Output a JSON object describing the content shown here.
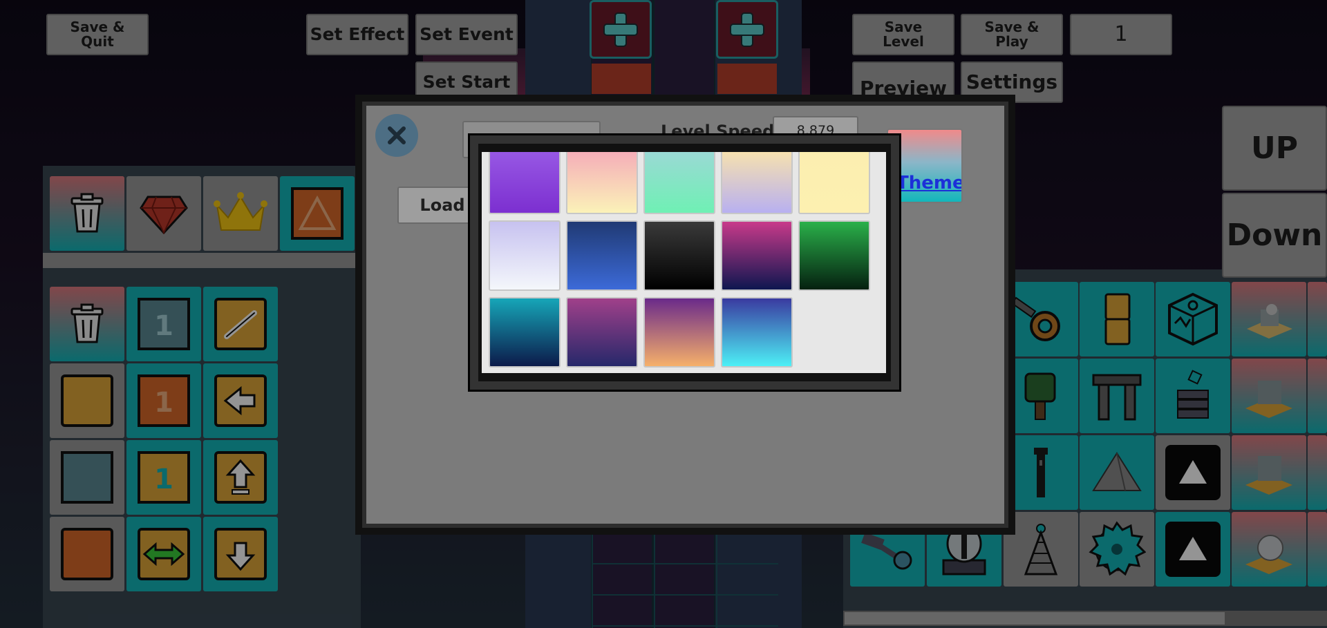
{
  "top_bar": {
    "save_quit": "Save &\nQuit",
    "set_effect": "Set Effect",
    "set_event": "Set Event",
    "set_start": "Set Start",
    "save_level": "Save\nLevel",
    "save_play": "Save &\nPlay",
    "level_number": "1",
    "preview": "Preview",
    "settings": "Settings"
  },
  "side_nav": {
    "up": "UP",
    "down": "Down"
  },
  "dialog": {
    "level_speed_label": "Level Speed:",
    "level_speed_value": "8.879",
    "load_label": "Load",
    "theme_label": "Theme"
  },
  "themes": [
    {
      "name": "purple-city",
      "top": "#9a5ce6",
      "bottom": "#7c2fd0"
    },
    {
      "name": "pink-castle",
      "top": "#f4a6b8",
      "bottom": "#fbf2b8"
    },
    {
      "name": "teal-castle",
      "top": "#9fd7d8",
      "bottom": "#6ff0b4"
    },
    {
      "name": "sunset-clouds",
      "top": "#fde6a8",
      "bottom": "#b8b0f0"
    },
    {
      "name": "yellow-clouds",
      "top": "#fbeeb0",
      "bottom": "#fdf0b0"
    },
    {
      "name": "white-crystal",
      "top": "#c7c2f0",
      "bottom": "#f4f7fb"
    },
    {
      "name": "blue-aurora",
      "top": "#203a74",
      "bottom": "#3c6ad8"
    },
    {
      "name": "dark-ruins",
      "top": "#3a3a3a",
      "bottom": "#000000"
    },
    {
      "name": "neon-night",
      "top": "#c83a8a",
      "bottom": "#0e1650"
    },
    {
      "name": "green-forest",
      "top": "#2ab04a",
      "bottom": "#052010"
    },
    {
      "name": "cyan-cave",
      "top": "#16a6b8",
      "bottom": "#0c1a4a"
    },
    {
      "name": "magenta-cave",
      "top": "#a0408a",
      "bottom": "#26286a"
    },
    {
      "name": "dusk-gradient",
      "top": "#6a2a8a",
      "bottom": "#f6b06a"
    },
    {
      "name": "ice-dome",
      "top": "#3a3aa0",
      "bottom": "#4df0f6"
    }
  ],
  "palette_left": {
    "top_row": [
      "trash",
      "red-gem",
      "crown",
      "orange-triangle-block"
    ],
    "grid": [
      "trash",
      "numbered-block-1",
      "slash-block",
      "yellow-block",
      "orange-numbered-block-1",
      "left-arrow-block",
      "grey-block",
      "cyan-numbered-block-1",
      "up-arrow-block",
      "orange-block",
      "left-right-arrow-block",
      "down-arrow-block"
    ]
  },
  "palette_right": {
    "items": [
      "pendulum",
      "pillar",
      "cube-shuffle",
      "block-stack-model",
      "tree",
      "archway",
      "block-tower",
      "block-stack-model-2",
      "dark-tower",
      "pyramid",
      "black-triangle-spike",
      "block-stack-model-3",
      "hammer",
      "capsule",
      "radio-tower",
      "sawblade",
      "black-triangle-spike-2",
      "dome-model"
    ]
  },
  "colors": {
    "accent": "#13b7bb",
    "button": "#a6a6a6",
    "dialog": "#7b7b7b",
    "theme_link": "#1c2fd8"
  }
}
